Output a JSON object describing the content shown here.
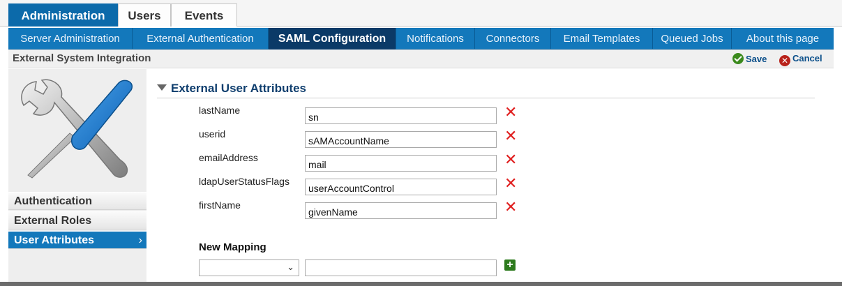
{
  "top_tabs": [
    {
      "label": "Administration"
    },
    {
      "label": "Users"
    },
    {
      "label": "Events"
    }
  ],
  "sub_nav": [
    {
      "label": "Server Administration"
    },
    {
      "label": "External Authentication"
    },
    {
      "label": "SAML Configuration"
    },
    {
      "label": "Notifications"
    },
    {
      "label": "Connectors"
    },
    {
      "label": "Email Templates"
    },
    {
      "label": "Queued Jobs"
    },
    {
      "label": "About this page"
    }
  ],
  "title_bar": {
    "title": "External System Integration",
    "save_label": "Save",
    "cancel_label": "Cancel"
  },
  "sidebar": {
    "items": [
      {
        "label": "Authentication"
      },
      {
        "label": "External Roles"
      },
      {
        "label": "User Attributes"
      }
    ]
  },
  "section": {
    "title": "External User Attributes"
  },
  "attributes": [
    {
      "name": "lastName",
      "value": "sn"
    },
    {
      "name": "userid",
      "value": "sAMAccountName"
    },
    {
      "name": "emailAddress",
      "value": "mail"
    },
    {
      "name": "ldapUserStatusFlags",
      "value": "userAccountControl"
    },
    {
      "name": "firstName",
      "value": "givenName"
    }
  ],
  "new_mapping": {
    "label": "New Mapping",
    "select_value": "",
    "input_value": ""
  },
  "icons": {
    "delete": "delete-x-icon",
    "add": "add-plus-icon",
    "save": "checkmark-icon",
    "cancel": "cancel-x-icon"
  },
  "colors": {
    "accent": "#1378bb",
    "active_subnav": "#0b3a67",
    "delete_red": "#e01f1f",
    "add_green": "#2d7a1d"
  }
}
